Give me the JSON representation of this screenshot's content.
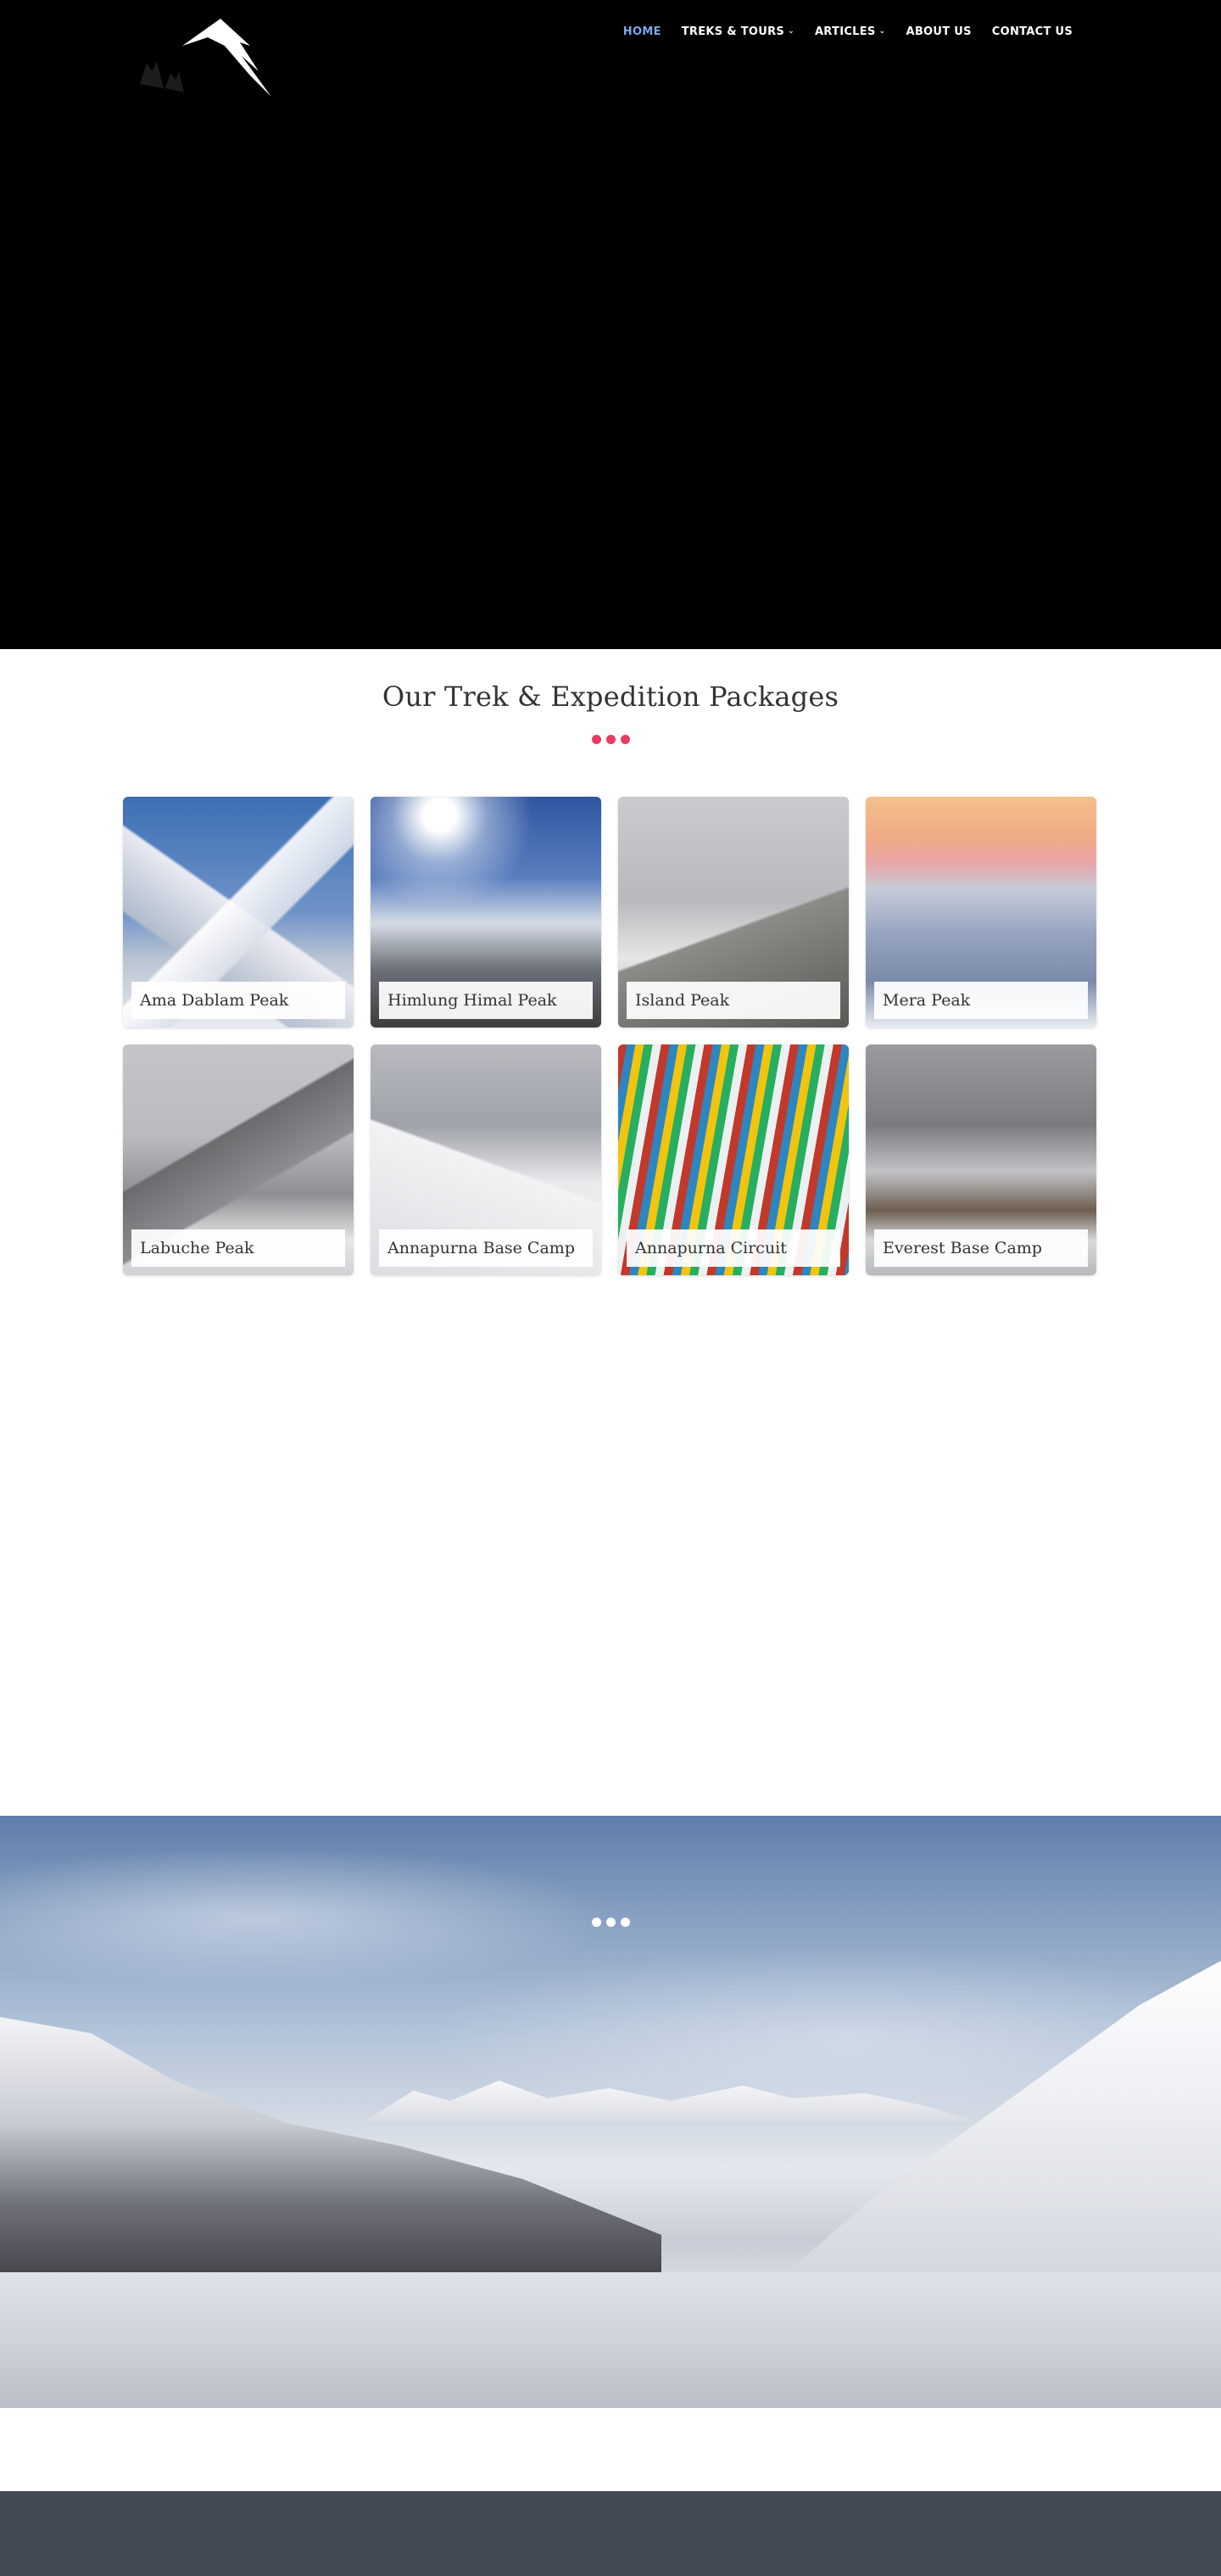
{
  "nav": {
    "items": [
      {
        "label": "HOME",
        "active": true,
        "dropdown": false
      },
      {
        "label": "TREKS & TOURS",
        "active": false,
        "dropdown": true
      },
      {
        "label": "ARTICLES",
        "active": false,
        "dropdown": true
      },
      {
        "label": "ABOUT US",
        "active": false,
        "dropdown": false
      },
      {
        "label": "CONTACT US",
        "active": false,
        "dropdown": false
      }
    ],
    "active_color": "#7ea7e6",
    "chevron_glyph": "⌄"
  },
  "packages": {
    "title": "Our Trek & Expedition Packages",
    "accent_color": "#e83a63",
    "cards": [
      {
        "label": "Ama Dablam Peak",
        "image": "ama-dablam-photo"
      },
      {
        "label": "Himlung Himal Peak",
        "image": "himlung-himal-photo"
      },
      {
        "label": "Island Peak",
        "image": "island-peak-photo"
      },
      {
        "label": "Mera Peak",
        "image": "mera-peak-photo"
      },
      {
        "label": "Labuche Peak",
        "image": "labuche-peak-photo"
      },
      {
        "label": "Annapurna Base Camp",
        "image": "annapurna-base-camp-photo"
      },
      {
        "label": "Annapurna Circuit",
        "image": "annapurna-circuit-photo"
      },
      {
        "label": "Everest Base Camp",
        "image": "everest-base-camp-photo"
      }
    ]
  },
  "colors": {
    "hero_background": "#000000",
    "footer_background": "#434a54"
  }
}
